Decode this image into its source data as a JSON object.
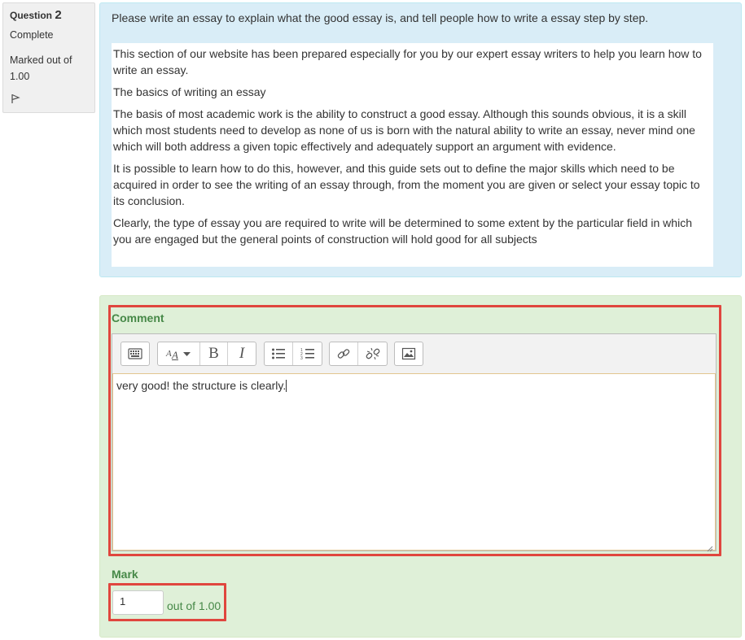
{
  "question": {
    "label": "Question",
    "number": "2",
    "state": "Complete",
    "grade_line1": "Marked out of",
    "grade_line2": "1.00",
    "flag_icon": "flag-icon"
  },
  "formulation": {
    "question_text": "Please write an essay to explain what the good essay is, and tell people how to write a essay step by step.",
    "answer_paragraphs": [
      "This section of our website has been prepared especially for you by our expert essay writers to help you learn how to write an essay.",
      "The basics of writing an essay",
      "The basis of most academic work is the ability to construct a good essay. Although this sounds obvious, it is a skill which most students need to develop as none of us is born with the natural ability to write an essay, never mind one which will both address a given topic effectively and adequately support an argument with evidence.",
      "It is possible to learn how to do this, however, and this guide sets out to define the major skills which need to be acquired in order to see the writing of an essay through, from the moment you are given or select your essay topic to its conclusion.",
      "Clearly, the type of essay you are required to write will be determined to some extent by the particular field in which you are engaged but the general points of construction will hold good for all subjects"
    ]
  },
  "comment": {
    "label": "Comment",
    "text": "very good! the structure is clearly.",
    "toolbar": {
      "toggle_icon": "keyboard-toggle-icon",
      "font_icon": "font-size-icon",
      "bold_label": "B",
      "italic_label": "I",
      "unordered_list_icon": "unordered-list-icon",
      "ordered_list_icon": "ordered-list-icon",
      "link_icon": "link-icon",
      "unlink_icon": "unlink-icon",
      "image_icon": "image-icon"
    }
  },
  "mark": {
    "label": "Mark",
    "value": "1",
    "out_of": "out of 1.00"
  },
  "colors": {
    "info_bg": "#f0f0f0",
    "formulation_bg": "#d9edf7",
    "comment_bg": "#dff0d8",
    "label_green": "#468847",
    "highlight_red": "#e0463e"
  }
}
